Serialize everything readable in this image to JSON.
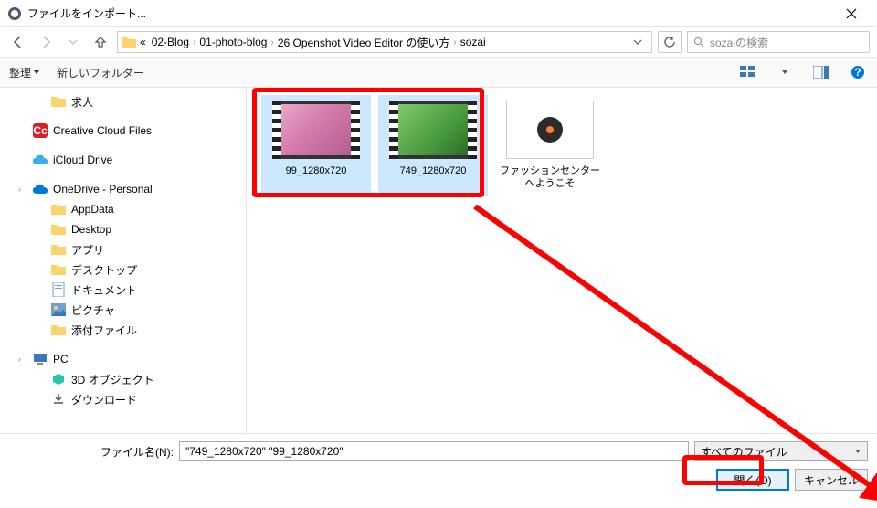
{
  "window": {
    "title": "ファイルをインポート..."
  },
  "breadcrumb": {
    "prefix": "«",
    "items": [
      "02-Blog",
      "01-photo-blog",
      "26 Openshot Video Editor の使い方",
      "sozai"
    ]
  },
  "search": {
    "placeholder": "sozaiの検索"
  },
  "toolbar": {
    "organize": "整理",
    "newfolder": "新しいフォルダー"
  },
  "tree": [
    {
      "label": "求人",
      "icon": "folder",
      "indent": 1
    },
    {
      "label": "Creative Cloud Files",
      "icon": "cc",
      "indent": 0
    },
    {
      "label": "iCloud Drive",
      "icon": "icloud",
      "indent": 0
    },
    {
      "label": "OneDrive - Personal",
      "icon": "onedrive",
      "indent": 0,
      "expandable": true
    },
    {
      "label": "AppData",
      "icon": "folder",
      "indent": 1
    },
    {
      "label": "Desktop",
      "icon": "folder",
      "indent": 1
    },
    {
      "label": "アプリ",
      "icon": "folder",
      "indent": 1
    },
    {
      "label": "デスクトップ",
      "icon": "folder",
      "indent": 1
    },
    {
      "label": "ドキュメント",
      "icon": "doc",
      "indent": 1
    },
    {
      "label": "ピクチャ",
      "icon": "pic",
      "indent": 1
    },
    {
      "label": "添付ファイル",
      "icon": "folder",
      "indent": 1
    },
    {
      "label": "PC",
      "icon": "pc",
      "indent": 0,
      "expandable": true
    },
    {
      "label": "3D オブジェクト",
      "icon": "3d",
      "indent": 1
    },
    {
      "label": "ダウンロード",
      "icon": "download",
      "indent": 1
    }
  ],
  "files": [
    {
      "name": "99_1280x720",
      "type": "video",
      "selected": true,
      "thumb": "sakura"
    },
    {
      "name": "749_1280x720",
      "type": "video",
      "selected": true,
      "thumb": "green"
    },
    {
      "name": "ファッションセンターへようこそ",
      "type": "file",
      "selected": false,
      "thumb": "disc"
    }
  ],
  "filename": {
    "label": "ファイル名(N):",
    "value": "\"749_1280x720\" \"99_1280x720\""
  },
  "filter": {
    "label": "すべてのファイル"
  },
  "buttons": {
    "open": "開く(O)",
    "cancel": "キャンセル"
  }
}
